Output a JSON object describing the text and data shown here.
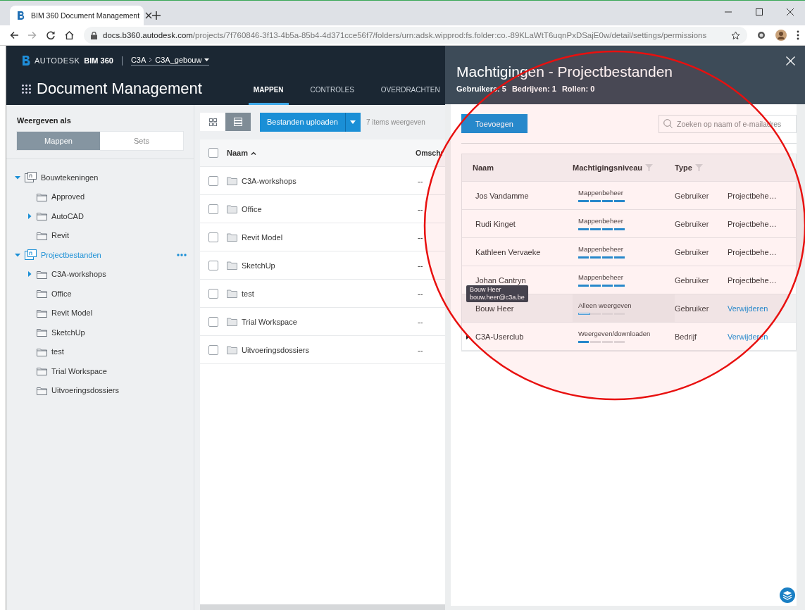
{
  "browser": {
    "tab_title": "BIM 360 Document Management",
    "url_host": "docs.b360.autodesk.com",
    "url_path": "/projects/7f760846-3f13-4b5a-85b4-4d371cce56f7/folders/urn:adsk.wipprod:fs.folder:co.-89KLaWtT6uqnPxDSajE0w/detail/settings/permissions"
  },
  "header": {
    "brand": "AUTODESK",
    "product": "BIM 360",
    "breadcrumb": [
      "C3A",
      "C3A_gebouw"
    ],
    "module": "Document Management",
    "tabs": [
      {
        "label": "MAPPEN",
        "selected": true
      },
      {
        "label": "CONTROLES",
        "selected": false
      },
      {
        "label": "OVERDRACHTEN",
        "selected": false
      }
    ]
  },
  "sidebar": {
    "view_label": "Weergeven als",
    "view_options": [
      {
        "label": "Mappen",
        "selected": true
      },
      {
        "label": "Sets",
        "selected": false
      }
    ],
    "tree": [
      {
        "label": "Bouwtekeningen",
        "kind": "root",
        "expanded": true,
        "selected": false,
        "children": [
          {
            "label": "Approved",
            "kind": "folder",
            "selected": false
          },
          {
            "label": "AutoCAD",
            "kind": "subfolders",
            "expanded": false,
            "selected": false
          },
          {
            "label": "Revit",
            "kind": "folder",
            "selected": false
          }
        ]
      },
      {
        "label": "Projectbestanden",
        "kind": "root",
        "expanded": true,
        "selected": true,
        "children": [
          {
            "label": "C3A-workshops",
            "kind": "subfolders",
            "expanded": false,
            "selected": false
          },
          {
            "label": "Office",
            "kind": "folder",
            "selected": false
          },
          {
            "label": "Revit Model",
            "kind": "folder",
            "selected": false
          },
          {
            "label": "SketchUp",
            "kind": "folder",
            "selected": false
          },
          {
            "label": "test",
            "kind": "folder",
            "selected": false
          },
          {
            "label": "Trial Workspace",
            "kind": "folder",
            "selected": false
          },
          {
            "label": "Uitvoeringsdossiers",
            "kind": "folder",
            "selected": false
          }
        ]
      }
    ]
  },
  "toolbar": {
    "view_modes": [
      {
        "kind": "grid",
        "selected": false
      },
      {
        "kind": "list",
        "selected": true
      }
    ],
    "upload_button": "Bestanden uploaden",
    "item_count": "7 items weergeven"
  },
  "table": {
    "columns": [
      "Naam",
      "Omschr"
    ],
    "select_all": {
      "checked": false
    },
    "rows": [
      {
        "name": "C3A-workshops",
        "column_2": "--",
        "checked": false
      },
      {
        "name": "Office",
        "column_2": "--",
        "checked": false
      },
      {
        "name": "Revit Model",
        "column_2": "--",
        "checked": false
      },
      {
        "name": "SketchUp",
        "column_2": "--",
        "checked": false
      },
      {
        "name": "test",
        "column_2": "--",
        "checked": false
      },
      {
        "name": "Trial Workspace",
        "column_2": "--",
        "checked": false
      },
      {
        "name": "Uitvoeringsdossiers",
        "column_2": "--",
        "checked": false
      }
    ]
  },
  "panel": {
    "title": "Machtigingen - Projectbestanden",
    "stats": [
      "Gebruikers: 5",
      "Bedrijven: 1",
      "Rollen: 0"
    ],
    "add_button": "Toevoegen",
    "search": {
      "placeholder": "Zoeken op naam of e-mailadres"
    },
    "columns": [
      "Naam",
      "Machtigingsniveau",
      "Type"
    ],
    "rows": [
      {
        "name": "Jos Vandamme",
        "kind": "user",
        "hovered": false,
        "permission": "Mappenbeheer",
        "level": 1,
        "type": "Gebruiker",
        "column_4": {
          "kind": "text",
          "text": "Projectbehe…"
        }
      },
      {
        "name": "Rudi Kinget",
        "kind": "user",
        "hovered": false,
        "permission": "Mappenbeheer",
        "level": 1,
        "type": "Gebruiker",
        "column_4": {
          "kind": "text",
          "text": "Projectbehe…"
        }
      },
      {
        "name": "Kathleen Vervaeke",
        "kind": "user",
        "hovered": false,
        "permission": "Mappenbeheer",
        "level": 1,
        "type": "Gebruiker",
        "column_4": {
          "kind": "text",
          "text": "Projectbehe…"
        }
      },
      {
        "name": "Johan Cantryn",
        "kind": "user",
        "hovered": false,
        "permission": "Mappenbeheer",
        "level": 1,
        "type": "Gebruiker",
        "column_4": {
          "kind": "text",
          "text": "Projectbehe…"
        }
      },
      {
        "name": "Bouw Heer",
        "kind": "user",
        "hovered": true,
        "permission": "Alleen weergeven",
        "level": 0.25,
        "type": "Gebruiker",
        "column_4": {
          "kind": "link",
          "text": "Verwijderen"
        }
      },
      {
        "name": "C3A-Userclub",
        "kind": "company",
        "hovered": false,
        "permission": "Weergeven/downloaden",
        "level": 0.25,
        "type": "Bedrijf",
        "column_4": {
          "kind": "link",
          "text": "Verwijderen"
        }
      }
    ],
    "tooltip": [
      "Bouw Heer",
      "bouw.heer@c3a.be"
    ]
  }
}
